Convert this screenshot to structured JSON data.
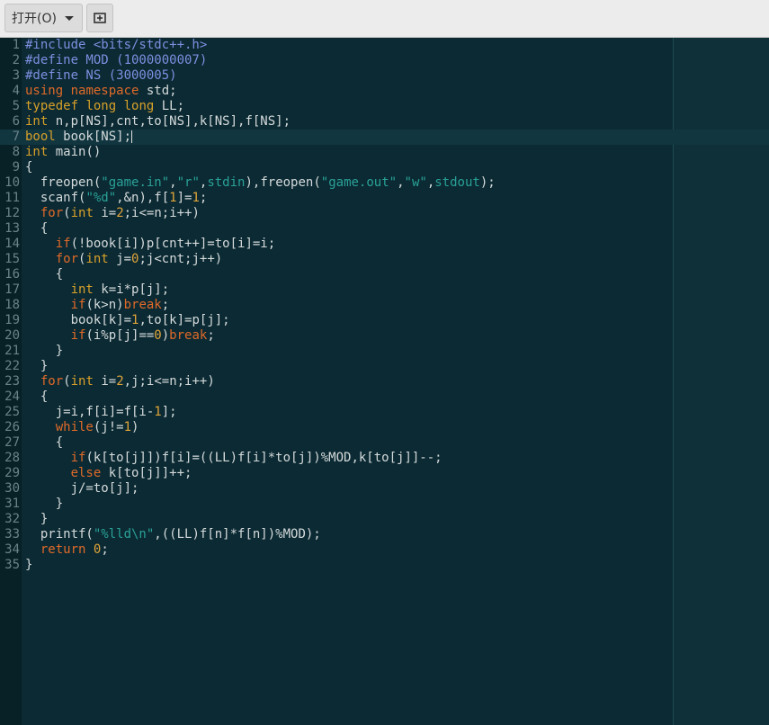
{
  "toolbar": {
    "open_label": "打开(O)",
    "new_icon": "new-document-icon"
  },
  "editor": {
    "current_line": 7,
    "lines": [
      [
        [
          "#include <bits/stdc++.h>",
          "pp"
        ]
      ],
      [
        [
          "#define MOD (1000000007)",
          "pp"
        ]
      ],
      [
        [
          "#define NS (3000005)",
          "pp"
        ]
      ],
      [
        [
          "using",
          "ns"
        ],
        [
          " "
        ],
        [
          "namespace",
          "ns"
        ],
        [
          " std;"
        ]
      ],
      [
        [
          "typedef",
          "kw"
        ],
        [
          " "
        ],
        [
          "long",
          "kw"
        ],
        [
          " "
        ],
        [
          "long",
          "kw"
        ],
        [
          " LL;"
        ]
      ],
      [
        [
          "int",
          "kw"
        ],
        [
          " n,p[NS],cnt,to[NS],k[NS],f[NS];"
        ]
      ],
      [
        [
          "bool",
          "kw"
        ],
        [
          " book[NS];"
        ]
      ],
      [
        [
          "int",
          "kw"
        ],
        [
          " main()"
        ]
      ],
      [
        [
          "{"
        ]
      ],
      [
        [
          "  freopen("
        ],
        [
          "\"game.in\"",
          "str"
        ],
        [
          ","
        ],
        [
          "\"r\"",
          "str"
        ],
        [
          ","
        ],
        [
          "stdin",
          "str"
        ],
        [
          "),freopen("
        ],
        [
          "\"game.out\"",
          "str"
        ],
        [
          ","
        ],
        [
          "\"w\"",
          "str"
        ],
        [
          ","
        ],
        [
          "stdout",
          "str"
        ],
        [
          ");"
        ]
      ],
      [
        [
          "  scanf("
        ],
        [
          "\"%d\"",
          "str"
        ],
        [
          ",&n),f["
        ],
        [
          "1",
          "num"
        ],
        [
          "]="
        ],
        [
          "1",
          "num"
        ],
        [
          ";"
        ]
      ],
      [
        [
          "  "
        ],
        [
          "for",
          "kw2"
        ],
        [
          "("
        ],
        [
          "int",
          "kw"
        ],
        [
          " i="
        ],
        [
          "2",
          "num"
        ],
        [
          ";i<=n;i++)"
        ]
      ],
      [
        [
          "  {"
        ]
      ],
      [
        [
          "    "
        ],
        [
          "if",
          "kw2"
        ],
        [
          "(!book[i])p[cnt++]=to[i]=i;"
        ]
      ],
      [
        [
          "    "
        ],
        [
          "for",
          "kw2"
        ],
        [
          "("
        ],
        [
          "int",
          "kw"
        ],
        [
          " j="
        ],
        [
          "0",
          "num"
        ],
        [
          ";j<cnt;j++)"
        ]
      ],
      [
        [
          "    {"
        ]
      ],
      [
        [
          "      "
        ],
        [
          "int",
          "kw"
        ],
        [
          " k=i*p[j];"
        ]
      ],
      [
        [
          "      "
        ],
        [
          "if",
          "kw2"
        ],
        [
          "(k>n)"
        ],
        [
          "break",
          "kw2"
        ],
        [
          ";"
        ]
      ],
      [
        [
          "      book[k]="
        ],
        [
          "1",
          "num"
        ],
        [
          ",to[k]=p[j];"
        ]
      ],
      [
        [
          "      "
        ],
        [
          "if",
          "kw2"
        ],
        [
          "(i%p[j]=="
        ],
        [
          "0",
          "num"
        ],
        [
          ")"
        ],
        [
          "break",
          "kw2"
        ],
        [
          ";"
        ]
      ],
      [
        [
          "    }"
        ]
      ],
      [
        [
          "  }"
        ]
      ],
      [
        [
          "  "
        ],
        [
          "for",
          "kw2"
        ],
        [
          "("
        ],
        [
          "int",
          "kw"
        ],
        [
          " i="
        ],
        [
          "2",
          "num"
        ],
        [
          ",j;i<=n;i++)"
        ]
      ],
      [
        [
          "  {"
        ]
      ],
      [
        [
          "    j=i,f[i]=f[i-"
        ],
        [
          "1",
          "num"
        ],
        [
          "];"
        ]
      ],
      [
        [
          "    "
        ],
        [
          "while",
          "kw2"
        ],
        [
          "(j!="
        ],
        [
          "1",
          "num"
        ],
        [
          ")"
        ]
      ],
      [
        [
          "    {"
        ]
      ],
      [
        [
          "      "
        ],
        [
          "if",
          "kw2"
        ],
        [
          "(k[to[j]])f[i]=((LL)f[i]*to[j])%MOD,k[to[j]]--;"
        ]
      ],
      [
        [
          "      "
        ],
        [
          "else",
          "kw2"
        ],
        [
          " k[to[j]]++;"
        ]
      ],
      [
        [
          "      j/=to[j];"
        ]
      ],
      [
        [
          "    }"
        ]
      ],
      [
        [
          "  }"
        ]
      ],
      [
        [
          "  printf("
        ],
        [
          "\"%lld\\n\"",
          "str"
        ],
        [
          ",((LL)f[n]*f[n])%MOD);"
        ]
      ],
      [
        [
          "  "
        ],
        [
          "return",
          "kw2"
        ],
        [
          " "
        ],
        [
          "0",
          "num"
        ],
        [
          ";"
        ]
      ],
      [
        [
          "}"
        ]
      ]
    ]
  }
}
